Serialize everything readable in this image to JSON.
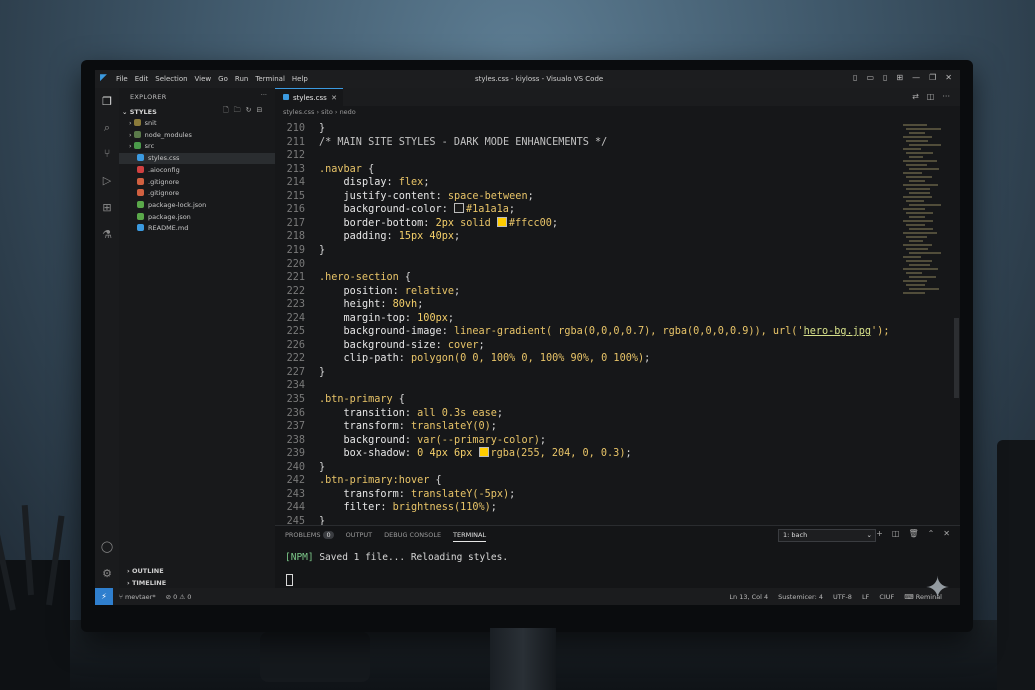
{
  "window": {
    "title": "styles.css - kiyloss - Visualo VS Code",
    "menu": [
      "File",
      "Edit",
      "Selection",
      "View",
      "Go",
      "Run",
      "Terminal",
      "Help"
    ]
  },
  "sidebar": {
    "header": "EXPLORER",
    "section": "STYLES",
    "items": [
      {
        "label": "snit",
        "type": "folder",
        "color": "#8a7a3a"
      },
      {
        "label": "node_modules",
        "type": "folder",
        "color": "#5a7a4a"
      },
      {
        "label": "src",
        "type": "folder",
        "color": "#4a9a4a"
      },
      {
        "label": "styles.css",
        "type": "file",
        "color": "#3b9ae0",
        "selected": true
      },
      {
        "label": ".aioconfig",
        "type": "file",
        "color": "#d04040"
      },
      {
        "label": ".gitignore",
        "type": "file",
        "color": "#d06040"
      },
      {
        "label": ".gitignore",
        "type": "file",
        "color": "#d06040"
      },
      {
        "label": "package-lock.json",
        "type": "file",
        "color": "#5aa84a"
      },
      {
        "label": "package.json",
        "type": "file",
        "color": "#5aa84a"
      },
      {
        "label": "README.md",
        "type": "file",
        "color": "#3b9ae0"
      }
    ],
    "outline": "OUTLINE",
    "timeline": "TIMELINE"
  },
  "editor": {
    "tab_label": "styles.css",
    "breadcrumb": "styles.css  ›  sito  ›  nedo"
  },
  "code_lines": [
    {
      "n": "210",
      "t": [
        [
          "plain",
          "}"
        ]
      ]
    },
    {
      "n": "211",
      "t": [
        [
          "comment",
          "/* MAIN SITE STYLES - DARK MODE ENHANCEMENTS */"
        ]
      ]
    },
    {
      "n": "212",
      "t": []
    },
    {
      "n": "213",
      "t": [
        [
          "sel",
          ".navbar"
        ],
        [
          "plain",
          " {"
        ]
      ]
    },
    {
      "n": "214",
      "t": [
        [
          "plain",
          "    "
        ],
        [
          "prop",
          "display"
        ],
        [
          "plain",
          ": "
        ],
        [
          "val",
          "flex"
        ],
        [
          "plain",
          ";"
        ]
      ]
    },
    {
      "n": "215",
      "t": [
        [
          "plain",
          "    "
        ],
        [
          "prop",
          "justify-content"
        ],
        [
          "plain",
          ": "
        ],
        [
          "val",
          "space-between"
        ],
        [
          "plain",
          ";"
        ]
      ]
    },
    {
      "n": "216",
      "t": [
        [
          "plain",
          "    "
        ],
        [
          "prop",
          "background-color"
        ],
        [
          "plain",
          ": "
        ],
        [
          "swatch",
          "#1a1a1a"
        ],
        [
          "val",
          "#1a1a1a"
        ],
        [
          "plain",
          ";"
        ]
      ]
    },
    {
      "n": "217",
      "t": [
        [
          "plain",
          "    "
        ],
        [
          "prop",
          "border-bottom"
        ],
        [
          "plain",
          ": "
        ],
        [
          "num",
          "2px"
        ],
        [
          "val",
          " solid "
        ],
        [
          "swatch",
          "#ffcc00"
        ],
        [
          "val",
          "#ffcc00"
        ],
        [
          "plain",
          ";"
        ]
      ]
    },
    {
      "n": "218",
      "t": [
        [
          "plain",
          "    "
        ],
        [
          "prop",
          "padding"
        ],
        [
          "plain",
          ": "
        ],
        [
          "num",
          "15px 40px"
        ],
        [
          "plain",
          ";"
        ]
      ]
    },
    {
      "n": "219",
      "t": [
        [
          "plain",
          "}"
        ]
      ]
    },
    {
      "n": "220",
      "t": []
    },
    {
      "n": "221",
      "t": [
        [
          "sel",
          ".hero-section"
        ],
        [
          "plain",
          " {"
        ]
      ]
    },
    {
      "n": "222",
      "t": [
        [
          "plain",
          "    "
        ],
        [
          "prop",
          "position"
        ],
        [
          "plain",
          ": "
        ],
        [
          "val",
          "relative"
        ],
        [
          "plain",
          ";"
        ]
      ]
    },
    {
      "n": "223",
      "t": [
        [
          "plain",
          "    "
        ],
        [
          "prop",
          "height"
        ],
        [
          "plain",
          ": "
        ],
        [
          "num",
          "80vh"
        ],
        [
          "plain",
          ";"
        ]
      ]
    },
    {
      "n": "224",
      "t": [
        [
          "plain",
          "    "
        ],
        [
          "prop",
          "margin-top"
        ],
        [
          "plain",
          ": "
        ],
        [
          "num",
          "100px"
        ],
        [
          "plain",
          ";"
        ]
      ]
    },
    {
      "n": "225",
      "t": [
        [
          "plain",
          "    "
        ],
        [
          "prop",
          "background-image"
        ],
        [
          "plain",
          ": "
        ],
        [
          "val",
          "linear-gradient( rgba(0,0,0,0.7), rgba(0,0,0,0.9)), url('"
        ],
        [
          "str",
          "hero-bg.jpg"
        ],
        [
          "val",
          "');"
        ]
      ]
    },
    {
      "n": "226",
      "t": [
        [
          "plain",
          "    "
        ],
        [
          "prop",
          "background-size"
        ],
        [
          "plain",
          ": "
        ],
        [
          "val",
          "cover"
        ],
        [
          "plain",
          ";"
        ]
      ]
    },
    {
      "n": "222",
      "t": [
        [
          "plain",
          "    "
        ],
        [
          "prop",
          "clip-path"
        ],
        [
          "plain",
          ": "
        ],
        [
          "val",
          "polygon(0 0, 100% 0, 100% 90%, 0 100%)"
        ],
        [
          "plain",
          ";"
        ]
      ]
    },
    {
      "n": "227",
      "t": [
        [
          "plain",
          "}"
        ]
      ]
    },
    {
      "n": "234",
      "t": []
    },
    {
      "n": "235",
      "t": [
        [
          "sel",
          ".btn-primary"
        ],
        [
          "plain",
          " {"
        ]
      ]
    },
    {
      "n": "236",
      "t": [
        [
          "plain",
          "    "
        ],
        [
          "prop",
          "transition"
        ],
        [
          "plain",
          ": "
        ],
        [
          "val",
          "all 0.3s ease"
        ],
        [
          "plain",
          ";"
        ]
      ]
    },
    {
      "n": "237",
      "t": [
        [
          "plain",
          "    "
        ],
        [
          "prop",
          "transform"
        ],
        [
          "plain",
          ": "
        ],
        [
          "val",
          "translateY(0)"
        ],
        [
          "plain",
          ";"
        ]
      ]
    },
    {
      "n": "238",
      "t": [
        [
          "plain",
          "    "
        ],
        [
          "prop",
          "background"
        ],
        [
          "plain",
          ": "
        ],
        [
          "val",
          "var(--primary-color)"
        ],
        [
          "plain",
          ";"
        ]
      ]
    },
    {
      "n": "239",
      "t": [
        [
          "plain",
          "    "
        ],
        [
          "prop",
          "box-shadow"
        ],
        [
          "plain",
          ": "
        ],
        [
          "num",
          "0 4px 6px "
        ],
        [
          "swatch",
          "#ffcc00"
        ],
        [
          "val",
          "rgba(255, 204, 0, 0.3)"
        ],
        [
          "plain",
          ";"
        ]
      ]
    },
    {
      "n": "240",
      "t": [
        [
          "plain",
          "}"
        ]
      ]
    },
    {
      "n": "242",
      "t": [
        [
          "sel",
          ".btn-primary:hover"
        ],
        [
          "plain",
          " {"
        ]
      ]
    },
    {
      "n": "243",
      "t": [
        [
          "plain",
          "    "
        ],
        [
          "prop",
          "transform"
        ],
        [
          "plain",
          ": "
        ],
        [
          "val",
          "translateY(-5px)"
        ],
        [
          "plain",
          ";"
        ]
      ]
    },
    {
      "n": "244",
      "t": [
        [
          "plain",
          "    "
        ],
        [
          "prop",
          "filter"
        ],
        [
          "plain",
          ": "
        ],
        [
          "val",
          "brightness(110%)"
        ],
        [
          "plain",
          ";"
        ]
      ]
    },
    {
      "n": "245",
      "t": [
        [
          "plain",
          "}"
        ]
      ]
    }
  ],
  "panel": {
    "tabs": [
      "PROBLEMS",
      "OUTPUT",
      "DEBUG CONSOLE",
      "TERMINAL"
    ],
    "problems_count": "0",
    "shell": "1: bach",
    "terminal_tag": "[NPM]",
    "terminal_text": " Saved 1 file... Reloading styles."
  },
  "status": {
    "branch": "mevtaer*",
    "problems": "⊘ 0 ⚠ 0",
    "position": "Ln 13, Col 4",
    "spaces": "Sustemicer: 4",
    "encoding": "UTF-8",
    "eol": "LF",
    "language": "CIUF",
    "terminal": "Reminal"
  },
  "colors": {
    "accent": "#3b9ae0",
    "selector": "#e8c468",
    "terminal_npm": "#7dc98a"
  }
}
